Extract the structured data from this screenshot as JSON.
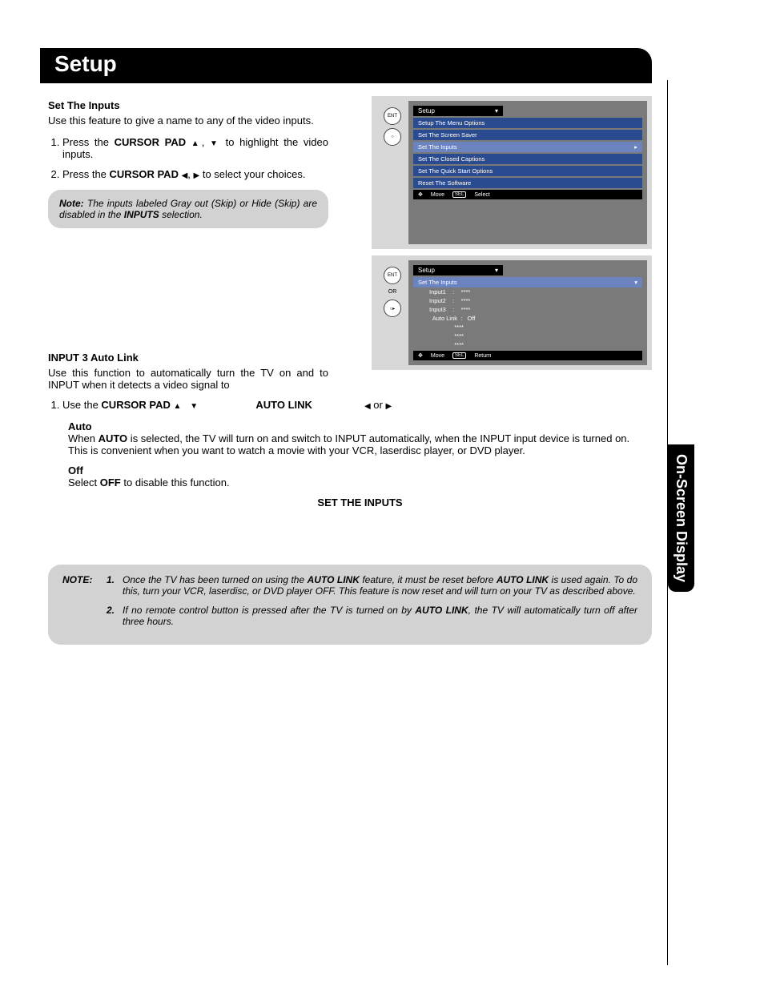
{
  "title": "Setup",
  "side_tab": "On-Screen Display",
  "sec1": {
    "heading": "Set The Inputs",
    "intro": "Use this feature to give a name to any of the video inputs.",
    "step1_a": "Press the ",
    "step1_bold": "CURSOR PAD ",
    "step1_b": ", ",
    "step1_c": " to highlight the video inputs.",
    "step2_a": "Press the ",
    "step2_bold": "CURSOR PAD ",
    "step2_b": ", ",
    "step2_c": " to select your choices.",
    "note_label": "Note:",
    "note_a": " The inputs labeled Gray out (Skip) or Hide (Skip) are disabled in the ",
    "note_bold": "INPUTS",
    "note_b": " selection."
  },
  "osd1": {
    "title": "Setup",
    "items": [
      "Setup The Menu Options",
      "Set The Screen Saver",
      "Set The Inputs",
      "Set The Closed Captions",
      "Set The Quick Start Options",
      "Reset The Software"
    ],
    "sel_index": 2,
    "foot_move": "Move",
    "foot_sel_box": "SEL",
    "foot_select": "Select"
  },
  "osd2": {
    "or": "OR",
    "title": "Setup",
    "sub": "Set The Inputs",
    "rows": [
      "Input1    :    ****",
      "Input2    :    ****",
      "Input3    :    ****",
      "  Auto Link  :   Off",
      "               ****",
      "               ****",
      "               ****"
    ],
    "foot_move": "Move",
    "foot_sel_box": "SEL",
    "foot_return": "Return"
  },
  "sec2": {
    "heading": "INPUT 3 Auto Link",
    "intro": "Use this function to automatically turn the TV on and to INPUT   when it detects a video signal to",
    "step1_a": "Use the ",
    "step1_bold": "CURSOR PAD ",
    "step1_gap1": "   ",
    "step1_autolink": "AUTO LINK",
    "step1_or": " or "
  },
  "auto": {
    "head": "Auto",
    "a": "When ",
    "b": "AUTO",
    "c": " is selected, the TV will turn on and switch to INPUT   automatically, when the INPUT    input device is turned on. This is convenient when you want to watch a movie with your VCR, laserdisc player, or DVD player."
  },
  "off": {
    "head": "Off",
    "a": "Select ",
    "b": "OFF",
    "c": " to disable this function."
  },
  "footer_bold": "SET THE INPUTS",
  "bignote": {
    "label": "NOTE:",
    "n1": "1.",
    "t1_a": "Once the TV has been turned on using the ",
    "t1_b": "AUTO LINK",
    "t1_c": " feature, it must be reset before ",
    "t1_d": "AUTO LINK",
    "t1_e": " is used again. To do this, turn your VCR, laserdisc, or DVD player OFF. This feature is now reset and will turn on your TV as described above.",
    "n2": "2.",
    "t2_a": "If no remote control button is pressed after the TV is turned on by ",
    "t2_b": "AUTO LINK",
    "t2_c": ", the TV will automatically turn off after three hours."
  },
  "glyph": {
    "up": "▲",
    "down": "▼",
    "left": "◀",
    "right": "▶",
    "dpad": "✥",
    "tri": "▸",
    "tri_down": "▾"
  }
}
